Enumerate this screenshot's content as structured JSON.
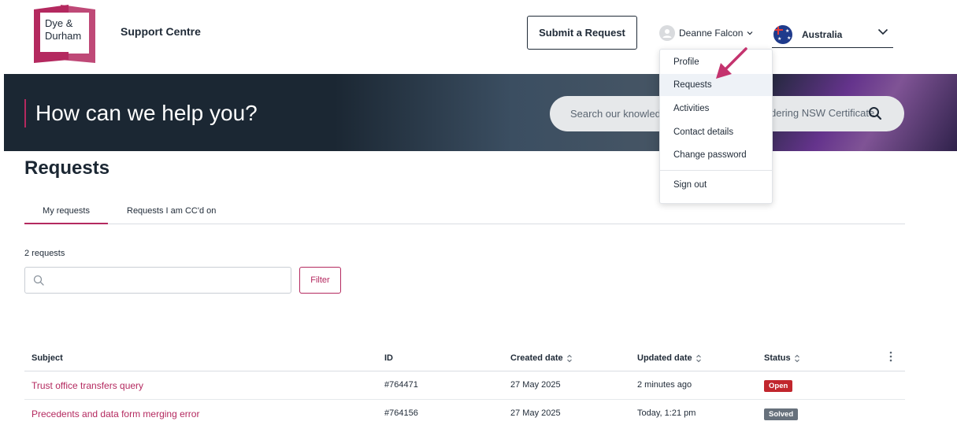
{
  "header": {
    "logo_line1": "Dye &",
    "logo_line2": "Durham",
    "support_title": "Support Centre",
    "submit_label": "Submit a Request",
    "user_name": "Deanne Falcon",
    "country": "Australia"
  },
  "user_menu": {
    "items": [
      "Profile",
      "Requests",
      "Activities",
      "Contact details",
      "Change password",
      "Sign out"
    ],
    "active": "Requests"
  },
  "hero": {
    "title": "How can we help you?",
    "search_placeholder_left": "Search our knowled",
    "search_placeholder_right": "dering NSW Certificate"
  },
  "requests": {
    "title": "Requests",
    "tabs": [
      "My requests",
      "Requests I am CC'd on"
    ],
    "count_label": "2 requests",
    "search_value": "",
    "filter_label": "Filter",
    "columns": [
      "Subject",
      "ID",
      "Created date",
      "Updated date",
      "Status"
    ],
    "rows": [
      {
        "subject": "Trust office transfers query",
        "id": "#764471",
        "created": "27 May 2025",
        "updated": "2 minutes ago",
        "status": "Open"
      },
      {
        "subject": "Precedents and data form merging error",
        "id": "#764156",
        "created": "27 May 2025",
        "updated": "Today, 1:21 pm",
        "status": "Solved"
      }
    ]
  },
  "colors": {
    "accent": "#b4295f",
    "hero_bg": "#1b2733",
    "open_badge": "#c1262d",
    "solved_badge": "#67717c"
  }
}
